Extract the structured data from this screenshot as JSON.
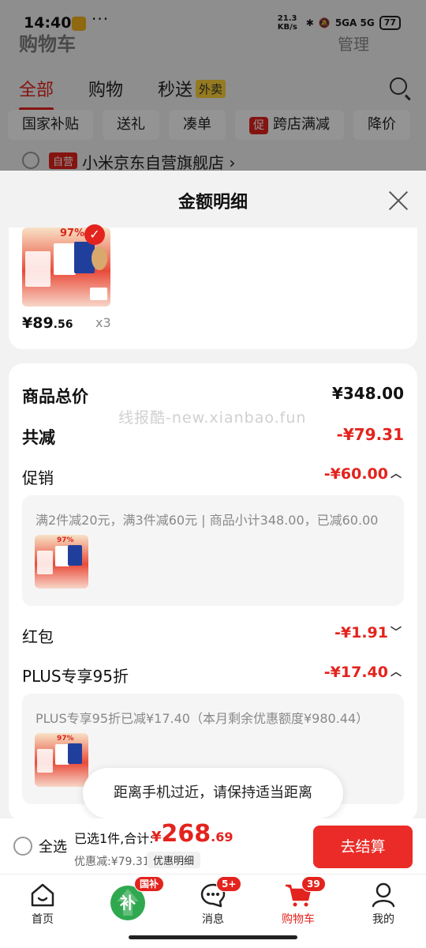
{
  "status_bar": {
    "time": "14:40",
    "net_speed": "21.3 KB/s",
    "signal": "5GA  5G",
    "battery": "77"
  },
  "background": {
    "title": "购物车",
    "manage": "管理",
    "tabs": [
      {
        "label": "全部"
      },
      {
        "label": "购物"
      },
      {
        "label": "秒送"
      }
    ],
    "waimai_tag": "外卖",
    "chips": [
      {
        "label": "国家补贴"
      },
      {
        "label": "送礼"
      },
      {
        "label": "凑单"
      },
      {
        "label": "跨店满减"
      },
      {
        "label": "降价"
      }
    ],
    "promo_tag": "促",
    "store_tag": "自营",
    "store_name": "小米京东自营旗舰店 ›"
  },
  "sheet": {
    "title": "金额明细",
    "product": {
      "img_pct": "97%",
      "price_int": "¥89",
      "price_dec": ".56",
      "qty": "x3"
    },
    "summary": [
      {
        "label": "商品总价",
        "value": "¥348.00"
      },
      {
        "label": "共减",
        "value": "-¥79.31"
      }
    ],
    "promo": {
      "label": "促销",
      "value": "-¥60.00",
      "detail": "满2件减20元，满3件减60元 | 商品小计348.00，已减60.00"
    },
    "redpacket": {
      "label": "红包",
      "value": "-¥1.91"
    },
    "plus": {
      "label": "PLUS专享95折",
      "value": "-¥17.40",
      "detail": "PLUS专享95折已减¥17.40（本月剩余优惠额度¥980.44）"
    },
    "watermark": "线报酷-new.xianbao.fun",
    "toast": "距离手机过近，请保持适当距离"
  },
  "checkout": {
    "select_all": "全选",
    "selected_text": "已选1件,合计:",
    "currency": "¥",
    "total_int": "268",
    "total_dec": ".69",
    "saved": "优惠减:¥79.31",
    "detail_btn": "优惠明细",
    "pay_btn": "去结算"
  },
  "nav": {
    "items": [
      {
        "label": "首页",
        "icon": "home-icon"
      },
      {
        "label": "",
        "icon": "subsidy-icon",
        "badge": "国补"
      },
      {
        "label": "消息",
        "icon": "message-icon",
        "badge": "5+"
      },
      {
        "label": "购物车",
        "icon": "cart-icon",
        "badge": "39"
      },
      {
        "label": "我的",
        "icon": "user-icon"
      }
    ]
  },
  "colors": {
    "accent": "#e3231d",
    "button": "#ea2b27"
  }
}
